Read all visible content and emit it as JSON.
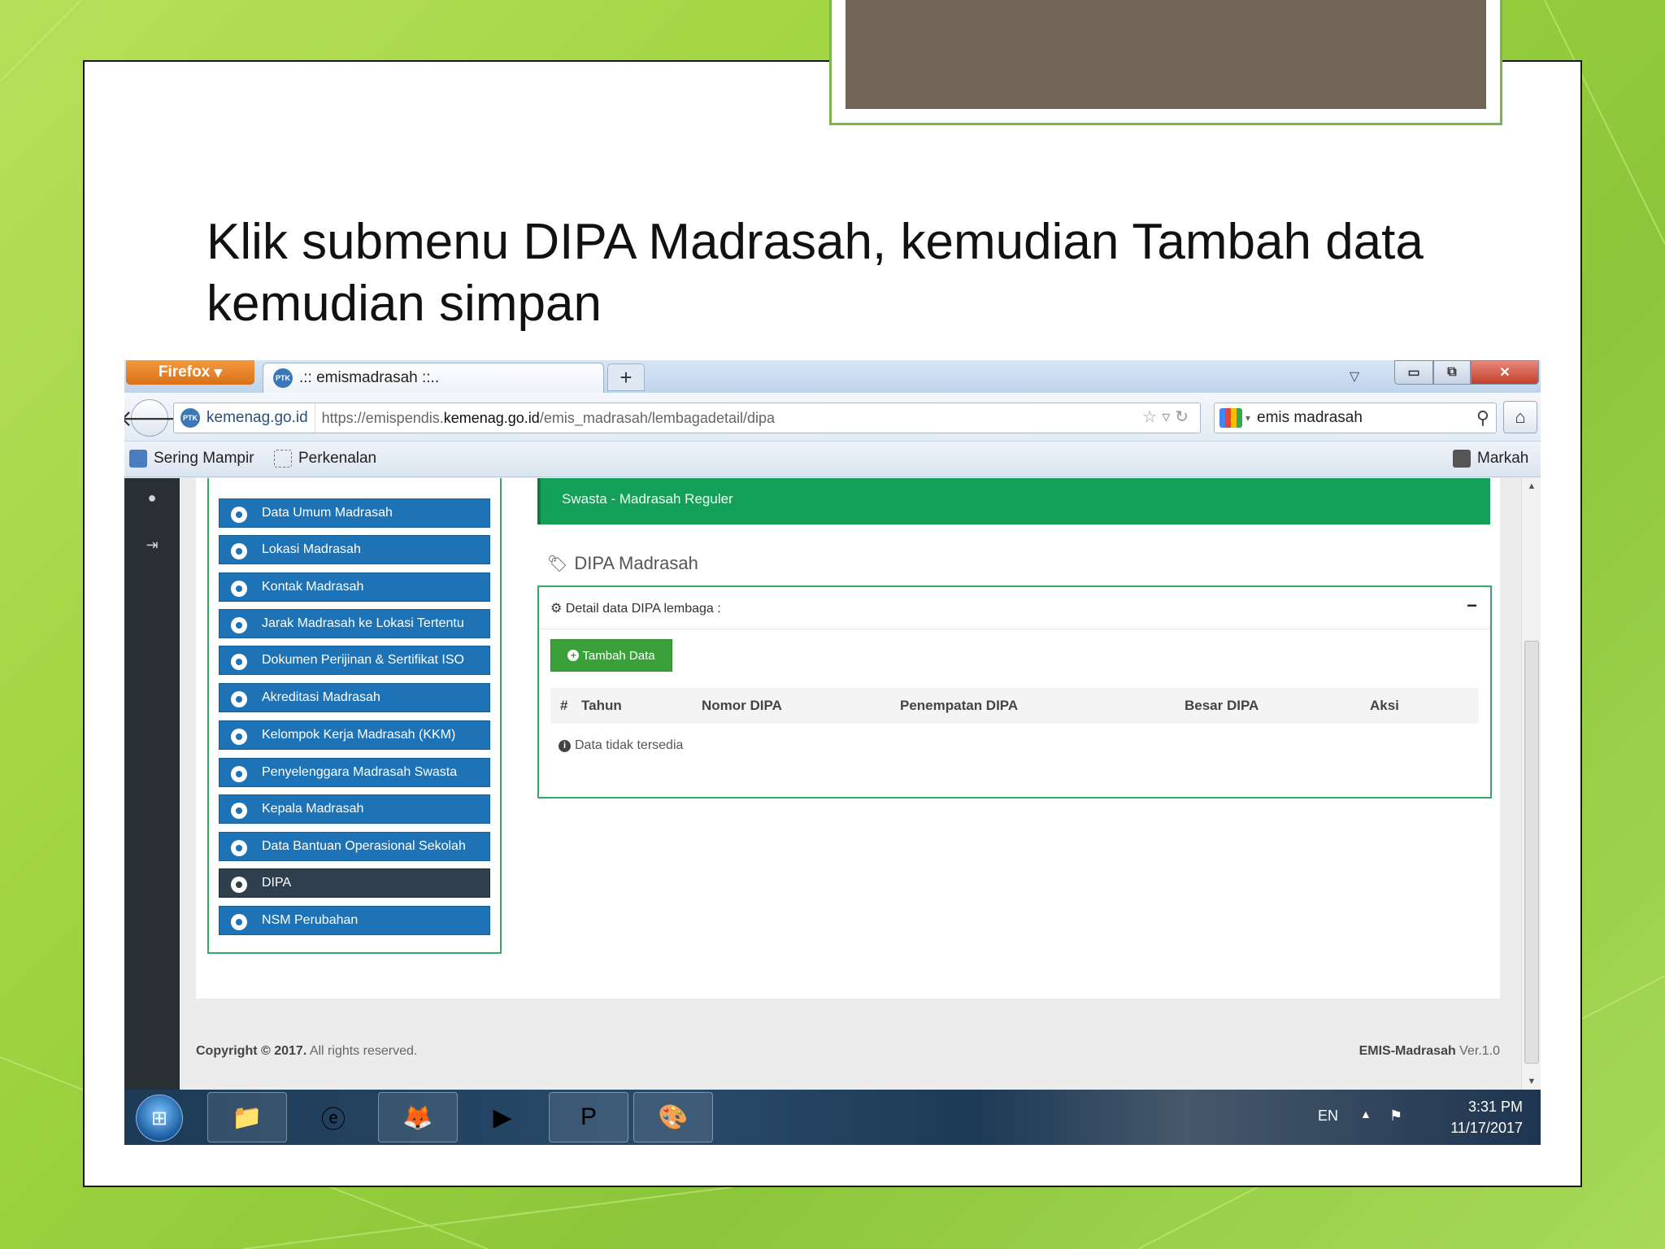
{
  "slide": {
    "title": "Klik submenu DIPA Madrasah, kemudian Tambah data kemudian simpan"
  },
  "browser": {
    "firefox_label": "Firefox",
    "tab_title": ".:: emismadrasah ::..",
    "new_tab_label": "+",
    "identity": "kemenag.go.id",
    "url_prefix": "https://emispendis.",
    "url_domain": "kemenag.go.id",
    "url_path": "/emis_madrasah/lembagadetail/dipa",
    "search_value": "emis madrasah",
    "bookmarks": [
      "Sering Mampir",
      "Perkenalan"
    ],
    "bookmarks_right": "Markah",
    "favicon_text": "PTK"
  },
  "page": {
    "banner_text": "Swasta - Madrasah Reguler",
    "menu": [
      {
        "label": "Data Umum Madrasah",
        "active": false
      },
      {
        "label": "Lokasi Madrasah",
        "active": false
      },
      {
        "label": "Kontak Madrasah",
        "active": false
      },
      {
        "label": "Jarak Madrasah ke Lokasi Tertentu",
        "active": false
      },
      {
        "label": "Dokumen Perijinan & Sertifikat ISO",
        "active": false
      },
      {
        "label": "Akreditasi Madrasah",
        "active": false
      },
      {
        "label": "Kelompok Kerja Madrasah (KKM)",
        "active": false
      },
      {
        "label": "Penyelenggara Madrasah Swasta",
        "active": false
      },
      {
        "label": "Kepala Madrasah",
        "active": false
      },
      {
        "label": "Data Bantuan Operasional Sekolah",
        "active": false
      },
      {
        "label": "DIPA",
        "active": true
      },
      {
        "label": "NSM Perubahan",
        "active": false
      }
    ],
    "section_title": "DIPA Madrasah",
    "detail_heading": "Detail data DIPA lembaga :",
    "collapse_label": "−",
    "add_button": "Tambah Data",
    "table_headers": [
      "#",
      "Tahun",
      "Nomor DIPA",
      "Penempatan DIPA",
      "Besar DIPA",
      "Aksi"
    ],
    "empty_message": "Data tidak tersedia",
    "footer_left_bold": "Copyright © 2017.",
    "footer_left_rest": " All rights reserved.",
    "footer_right_bold": "EMIS-Madrasah",
    "footer_right_rest": " Ver.1.0"
  },
  "taskbar": {
    "lang": "EN",
    "time": "3:31 PM",
    "date": "11/17/2017"
  },
  "colors": {
    "menu_blue": "#1d73b5",
    "menu_active": "#2f3f4e",
    "banner_green": "#14a058",
    "button_green": "#3aa039",
    "slide_bg_green": "#9fd33f"
  }
}
